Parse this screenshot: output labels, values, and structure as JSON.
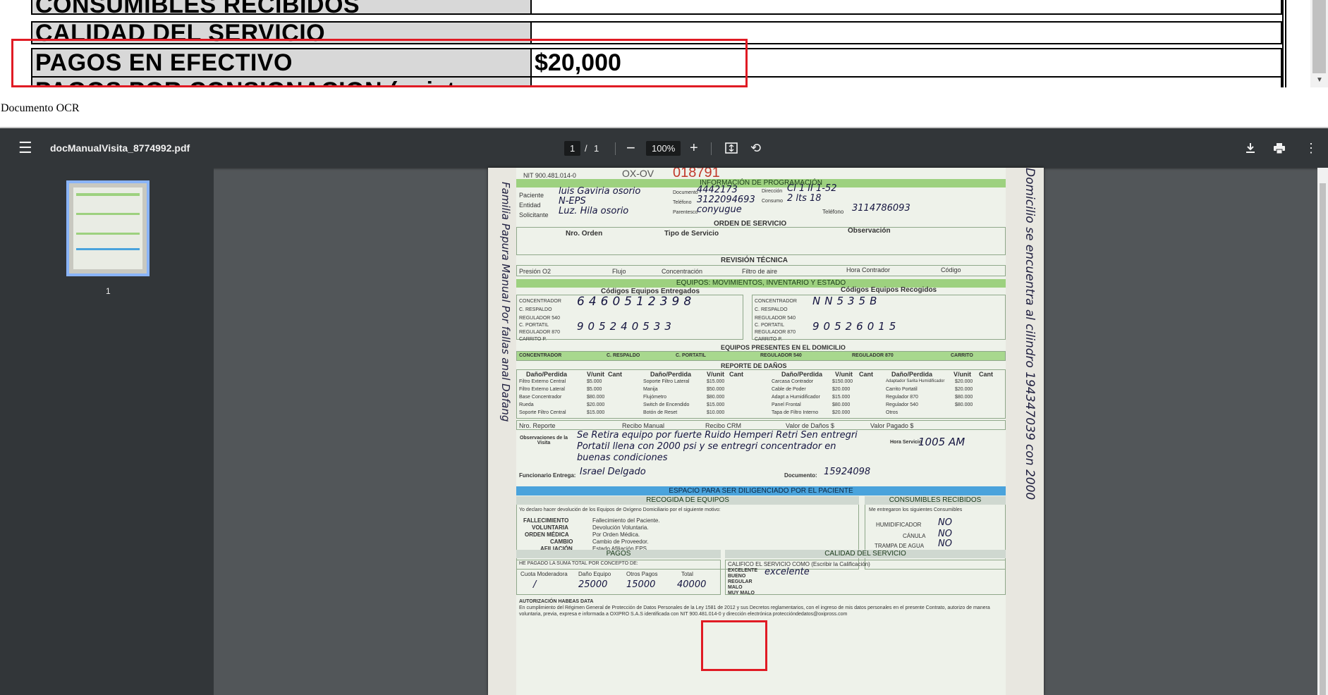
{
  "top_table": {
    "rows": [
      {
        "label": "CONSUMIBLES RECIBIDOS",
        "value": ""
      },
      {
        "label": "CALIDAD DEL SERVICIO",
        "value": ""
      },
      {
        "label": "PAGOS EN EFECTIVO",
        "value": "$20,000"
      },
      {
        "label": "PAGOS POR CONSIGNACION (sujeto a",
        "value": ""
      }
    ]
  },
  "ocr_label": "Documento OCR",
  "viewer": {
    "title": "docManualVisita_8774992.pdf",
    "page_current": "1",
    "page_separator": "/",
    "page_total": "1",
    "zoom": "100%",
    "thumbnail_label": "1"
  },
  "icons": {
    "menu": "hamburger-menu-icon",
    "zoom_out": "minus-icon",
    "zoom_in": "plus-icon",
    "fit": "fit-to-page-icon",
    "rotate": "rotate-icon",
    "download": "download-icon",
    "print": "print-icon",
    "more": "more-vertical-icon"
  },
  "document": {
    "nit": "NIT 900.481.014-0",
    "order_code": "OX-OV",
    "order_number": "018791",
    "section_programacion": "INFORMACIÓN DE PROGRAMACIÓN",
    "lbl_paciente": "Paciente",
    "val_paciente": "luis Gaviria osorio",
    "lbl_documento": "Documento",
    "val_documento": "4442173",
    "lbl_direccion": "Dirección",
    "val_direccion": "Cl 1 II 1-52",
    "lbl_entidad": "Entidad",
    "val_entidad": "N-EPS",
    "lbl_telefono": "Teléfono",
    "val_telefono": "3122094693",
    "lbl_consumo": "Consumo",
    "val_consumo": "2 lts 18",
    "lbl_solicitante": "Solicitante",
    "val_solicitante": "Luz. Hila osorio",
    "lbl_parentesco": "Parentesco",
    "val_parentesco": "conyugue",
    "lbl_telefono2": "Teléfono",
    "val_telefono2": "3114786093",
    "section_orden": "ORDEN DE SERVICIO",
    "lbl_nro_orden": "Nro. Orden",
    "lbl_tipo_servicio": "Tipo de Servicio",
    "lbl_observacion": "Observación",
    "section_revision": "REVISIÓN TÉCNICA",
    "lbl_presion": "Presión O2",
    "lbl_flujo": "Flujo",
    "lbl_concentracion": "Concentración",
    "lbl_filtro_aire": "Filtro de aire",
    "lbl_hora_contrador": "Hora Contrador",
    "lbl_codigo": "Código",
    "section_equipos": "EQUIPOS: MOVIMIENTOS, INVENTARIO Y ESTADO",
    "lbl_entregados": "Códigos Equipos Entregados",
    "lbl_recogidos": "Códigos Equipos Recogidos",
    "equipos_labels": [
      "CONCENTRADOR",
      "C. RESPALDO",
      "REGULADOR 540",
      "C. PORTATIL",
      "REGULADOR 870",
      "CARRITO P."
    ],
    "val_concentrador_entregado": "6460512398",
    "val_portatil_entregado": "905240533",
    "val_concentrador_recogido": "NN535B",
    "val_portatil_recogido": "90526015",
    "section_presentes": "EQUIPOS PRESENTES EN EL DOMICILIO",
    "presentes": [
      "CONCENTRADOR",
      "C. RESPALDO",
      "C. PORTATIL",
      "REGULADOR 540",
      "REGULADOR 870",
      "CARRITO"
    ],
    "section_danos": "REPORTE DE DAÑOS",
    "danos_headers": [
      "Daño/Perdida",
      "V/unit",
      "Cant"
    ],
    "danos_col1": [
      [
        "Filtro Externo Central",
        "$5.000"
      ],
      [
        "Filtro Externo Lateral",
        "$5.000"
      ],
      [
        "Base Concentrador",
        "$80.000"
      ],
      [
        "Rueda",
        "$20.000"
      ],
      [
        "Soporte Filtro Central",
        "$15.000"
      ]
    ],
    "danos_col2": [
      [
        "Soporte Filtro Lateral",
        "$15.000"
      ],
      [
        "Manija",
        "$50.000"
      ],
      [
        "Flujómetro",
        "$80.000"
      ],
      [
        "Switch de Encendido",
        "$15.000"
      ],
      [
        "Botón de Reset",
        "$10.000"
      ]
    ],
    "danos_col3": [
      [
        "Carcasa Contrador",
        "$150.000"
      ],
      [
        "Cable de Poder",
        "$20.000"
      ],
      [
        "Adapt a Humidificador",
        "$15.000"
      ],
      [
        "Panel Frontal",
        "$80.000"
      ],
      [
        "Tapa de Filtro Interno",
        "$20.000"
      ]
    ],
    "danos_col4": [
      [
        "Adaptador Sarita Humidificador",
        "$20.000"
      ],
      [
        "Carrito Portatil",
        "$20.000"
      ],
      [
        "Regulador 870",
        "$80.000"
      ],
      [
        "Regulador 540",
        "$80.000"
      ],
      [
        "Otros",
        ""
      ]
    ],
    "lbl_nro_reporte": "Nro. Reporte",
    "lbl_recibo_manual": "Recibo Manual",
    "lbl_recibo_crm": "Recibo CRM",
    "lbl_valor_danos": "Valor de Daños $",
    "lbl_valor_pagado": "Valor Pagado $",
    "lbl_observaciones": "Observaciones de la Visita",
    "val_observaciones_1": "Se Retira equipo por fuerte Ruido Hemperi Retri Sen entregri",
    "val_observaciones_2": "Portatil llena con 2000 psi y se entregri concentrador en",
    "val_observaciones_3": "buenas condiciones",
    "lbl_hora_servicio": "Hora Servicio",
    "val_hora_servicio": "1005 AM",
    "lbl_funcionario": "Funcionario Entrega:",
    "val_funcionario": "Israel Delgado",
    "lbl_documento_func": "Documento:",
    "val_documento_func": "15924098",
    "section_paciente": "ESPACIO PARA SER DILIGENCIADO POR EL PACIENTE",
    "section_recogida": "RECOGIDA DE EQUIPOS",
    "section_consumibles": "CONSUMIBLES RECIBIDOS",
    "recogida_text": "Yo declaro hacer devolución de los Equipos de Oxígeno Domiciliario por el siguiente motivo:",
    "recogida_items": [
      [
        "FALLECIMIENTO",
        "Fallecimiento del Paciente."
      ],
      [
        "VOLUNTARIA",
        "Devolución Voluntaria."
      ],
      [
        "ORDEN MÉDICA",
        "Por Orden Médica."
      ],
      [
        "CAMBIO",
        "Cambio de Proveedor."
      ],
      [
        "AFILIACIÓN",
        "Estado Afiliación EPS."
      ]
    ],
    "consumibles_text": "Me entregaron los siguientes Consumibles",
    "consumibles_items": [
      [
        "HUMIDIFICADOR",
        "NO"
      ],
      [
        "CÁNULA",
        "NO"
      ],
      [
        "TRAMPA DE AGUA",
        "NO"
      ]
    ],
    "section_pagos": "PAGOS",
    "section_calidad": "CALIDAD DEL SERVICIO",
    "pagos_text": "HE PAGADO LA SUMA TOTAL POR CONCEPTO DE:",
    "pagos_headers": [
      "Cuota Moderadora",
      "Daño Equipo",
      "Otros Pagos",
      "Total"
    ],
    "pagos_values": [
      "/",
      "25000",
      "15000",
      "40000"
    ],
    "calidad_text": "CALIFICO EL SERVICIO COMO (Escribir la Calificación)",
    "calidad_options": [
      "EXCELENTE",
      "BUENO",
      "REGULAR",
      "MALO",
      "MUY MALO"
    ],
    "val_calidad": "excelente",
    "habeas_title": "AUTORIZACIÓN HABEAS DATA",
    "habeas_text": "En cumplimiento del Régimen General de Protección de Datos Personales de la Ley 1581 de 2012 y sus Decretos reglamentarios, con el ingreso de mis datos personales en el presente Contrato, autorizo de manera voluntaria, previa, expresa e informada a OXIPRO S.A.S identificada con NIT 900.481.014-0 y dirección electrónica proteccióndedatos@oxipross.com"
  },
  "left_margin_note": "Familia Papura Manual Por fallas anal Dafang",
  "right_margin_note": "Domicilio se encuentra al cilindro 194347039 con 2000"
}
